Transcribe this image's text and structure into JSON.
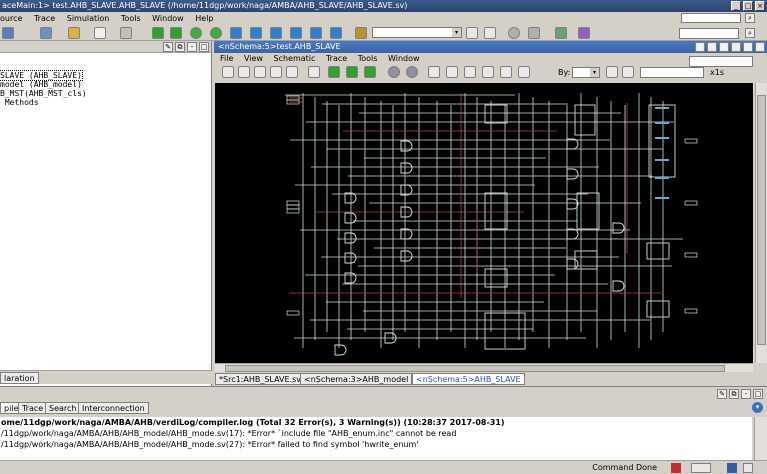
{
  "window": {
    "title": "aceMain:1> test.AHB_SLAVE.AHB_SLAVE (/home/11dgp/work/naga/AMBA/AHB_SLAVE/AHB_SLAVE.sv)"
  },
  "menubar": {
    "items": [
      "ource",
      "Trace",
      "Simulation",
      "Tools",
      "Window",
      "Help"
    ]
  },
  "left_panel": {
    "tree": [
      "SLAVE (AHB_SLAVE)",
      "model (AHB_model)",
      "B_MST(AHB_MST_cls)",
      " Methods"
    ],
    "tab": "laration"
  },
  "schematic": {
    "title": "<nSchema:5>test.AHB_SLAVE",
    "menu": [
      "File",
      "View",
      "Schematic",
      "Trace",
      "Tools",
      "Window"
    ],
    "by_label": "By:",
    "unit_label": "x1s",
    "tabs": [
      "*Src1:AHB_SLAVE.sv",
      "<nSchema:3>AHB_model",
      "<nSchema:5>AHB_SLAVE"
    ]
  },
  "message_panel": {
    "tabs": [
      "pile",
      "Trace",
      "Search",
      "Interconnection"
    ],
    "lines": [
      "ome/11dgp/work/naga/AMBA/AHB/verdiLog/compiler.log (Total 32 Error(s), 3 Warning(s)) (10:28:37 2017-08-31)",
      "/11dgp/work/naga/AMBA/AHB/AHB_model/AHB_mode.sv(17): *Error* `include file \"AHB_enum.inc\" cannot be read",
      "/11dgp/work/naga/AMBA/AHB/AHB_model/AHB_mode.sv(27): *Error* failed to find symbol 'hwrite_enum'"
    ]
  },
  "status": {
    "text": "Command Done"
  },
  "colors": {
    "canvas": "#000000",
    "wire": "#cfe8d8",
    "wire_red": "#c04050",
    "cell": "#6aa8d8",
    "title_active": "#3a64a8"
  },
  "icons": [
    "open-icon",
    "save-icon",
    "undo-icon",
    "find-icon",
    "green-flag-icon",
    "back-arrow-icon",
    "forward-arrow-icon",
    "zoom-in-icon",
    "zoom-out-icon",
    "zoom-fit-icon"
  ]
}
